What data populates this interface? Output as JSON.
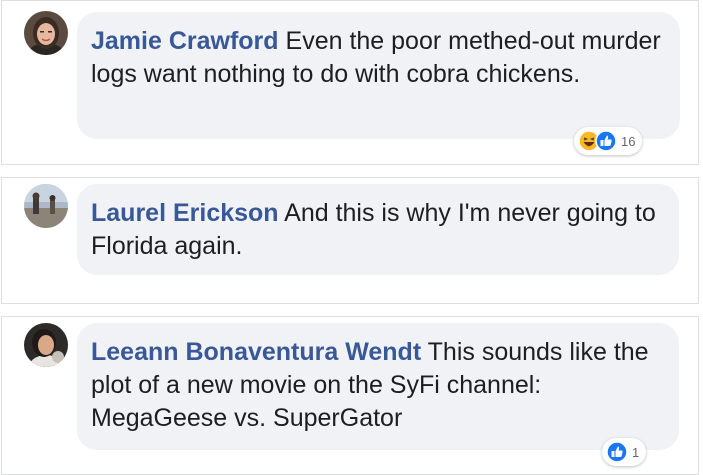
{
  "comments": [
    {
      "author": "Jamie Crawford",
      "text": "Even the poor methed-out murder logs want nothing to do with cobra chickens.",
      "reactions": [
        "haha-icon",
        "like-icon"
      ],
      "reaction_count": "16"
    },
    {
      "author": "Laurel Erickson",
      "text": "And this is why I'm never going to Florida again.",
      "reactions": [],
      "reaction_count": ""
    },
    {
      "author": "Leeann Bonaventura Wendt",
      "text": "This sounds like the plot of a new movie on the SyFi channel: MegaGeese vs. SuperGator",
      "reactions": [
        "like-icon"
      ],
      "reaction_count": "1"
    }
  ],
  "colors": {
    "author": "#385898",
    "text": "#1c1e21",
    "bubble": "#f0f2f5",
    "like": "#1877f2",
    "haha": "#f7b928"
  }
}
